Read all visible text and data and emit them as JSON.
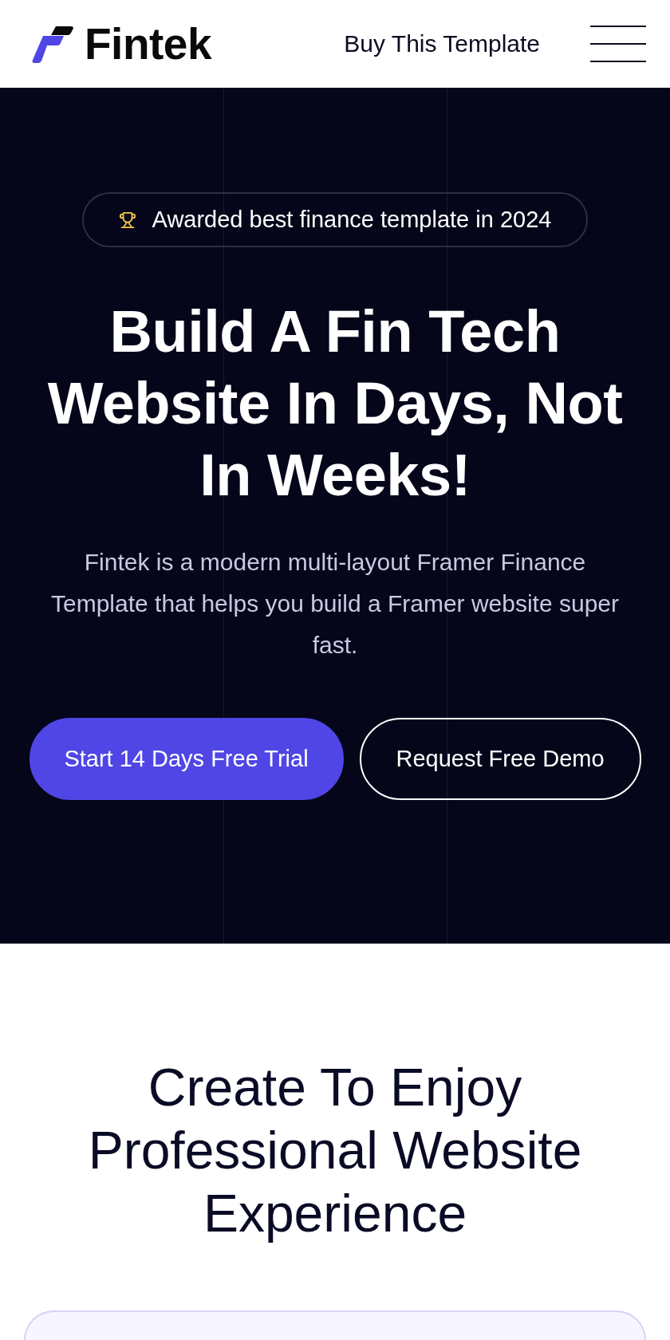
{
  "header": {
    "logo_text": "Fintek",
    "link": "Buy This Template"
  },
  "hero": {
    "badge": "Awarded best finance template in 2024",
    "headline": "Build A Fin Tech Website In Days, Not In Weeks!",
    "description": "Fintek is a modern multi-layout Framer Finance Template that helps you build a Framer website super fast.",
    "buttons": [
      {
        "label": "Start 14 Days Free Trial",
        "kind": "primary"
      },
      {
        "label": "Request Free Demo",
        "kind": "outline"
      }
    ]
  },
  "section": {
    "heading": "Create To Enjoy Professional Website Experience"
  }
}
